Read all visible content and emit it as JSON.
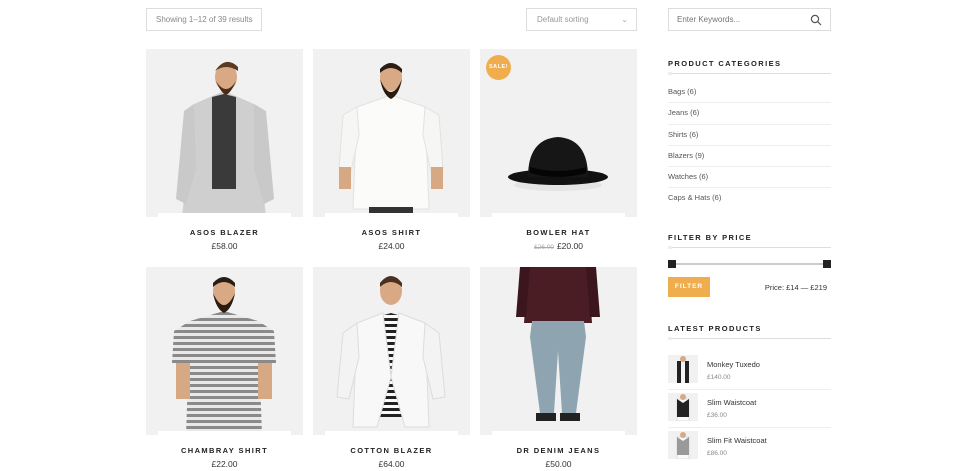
{
  "toolbar": {
    "result_count": "Showing 1–12 of 39 results",
    "sort_value": "Default sorting"
  },
  "products": [
    {
      "name": "ASOS BLAZER",
      "price": "£58.00",
      "image": "man-grey-blazer"
    },
    {
      "name": "ASOS SHIRT",
      "price": "£24.00",
      "image": "man-white-shirt"
    },
    {
      "name": "BOWLER HAT",
      "old_price": "£26.00",
      "price": "£20.00",
      "badge": "SALE!",
      "image": "black-bowler-hat"
    },
    {
      "name": "CHAMBRAY SHIRT",
      "price": "£22.00",
      "image": "man-striped-shirt"
    },
    {
      "name": "COTTON BLAZER",
      "price": "£64.00",
      "image": "man-white-blazer"
    },
    {
      "name": "DR DENIM JEANS",
      "price": "£50.00",
      "image": "man-denim-jeans"
    }
  ],
  "sidebar": {
    "search_placeholder": "Enter Keywords...",
    "categories_title": "PRODUCT CATEGORIES",
    "categories": [
      {
        "label": "Bags (6)"
      },
      {
        "label": "Jeans (6)"
      },
      {
        "label": "Shirts (6)"
      },
      {
        "label": "Blazers (9)"
      },
      {
        "label": "Watches (6)"
      },
      {
        "label": "Caps & Hats (6)"
      }
    ],
    "price_filter_title": "FILTER BY PRICE",
    "price_min_fraction": 0.0,
    "price_max_fraction": 1.0,
    "filter_button": "FILTER",
    "price_range": "Price: £14 — £219",
    "latest_title": "LATEST PRODUCTS",
    "latest": [
      {
        "name": "Monkey Tuxedo",
        "price": "£140.00"
      },
      {
        "name": "Slim Waistcoat",
        "price": "£36.00"
      },
      {
        "name": "Slim Fit Waistcoat",
        "price": "£86.00"
      }
    ]
  },
  "colors": {
    "accent": "#f0ad4e",
    "image_bg": "#f1f1f1"
  }
}
